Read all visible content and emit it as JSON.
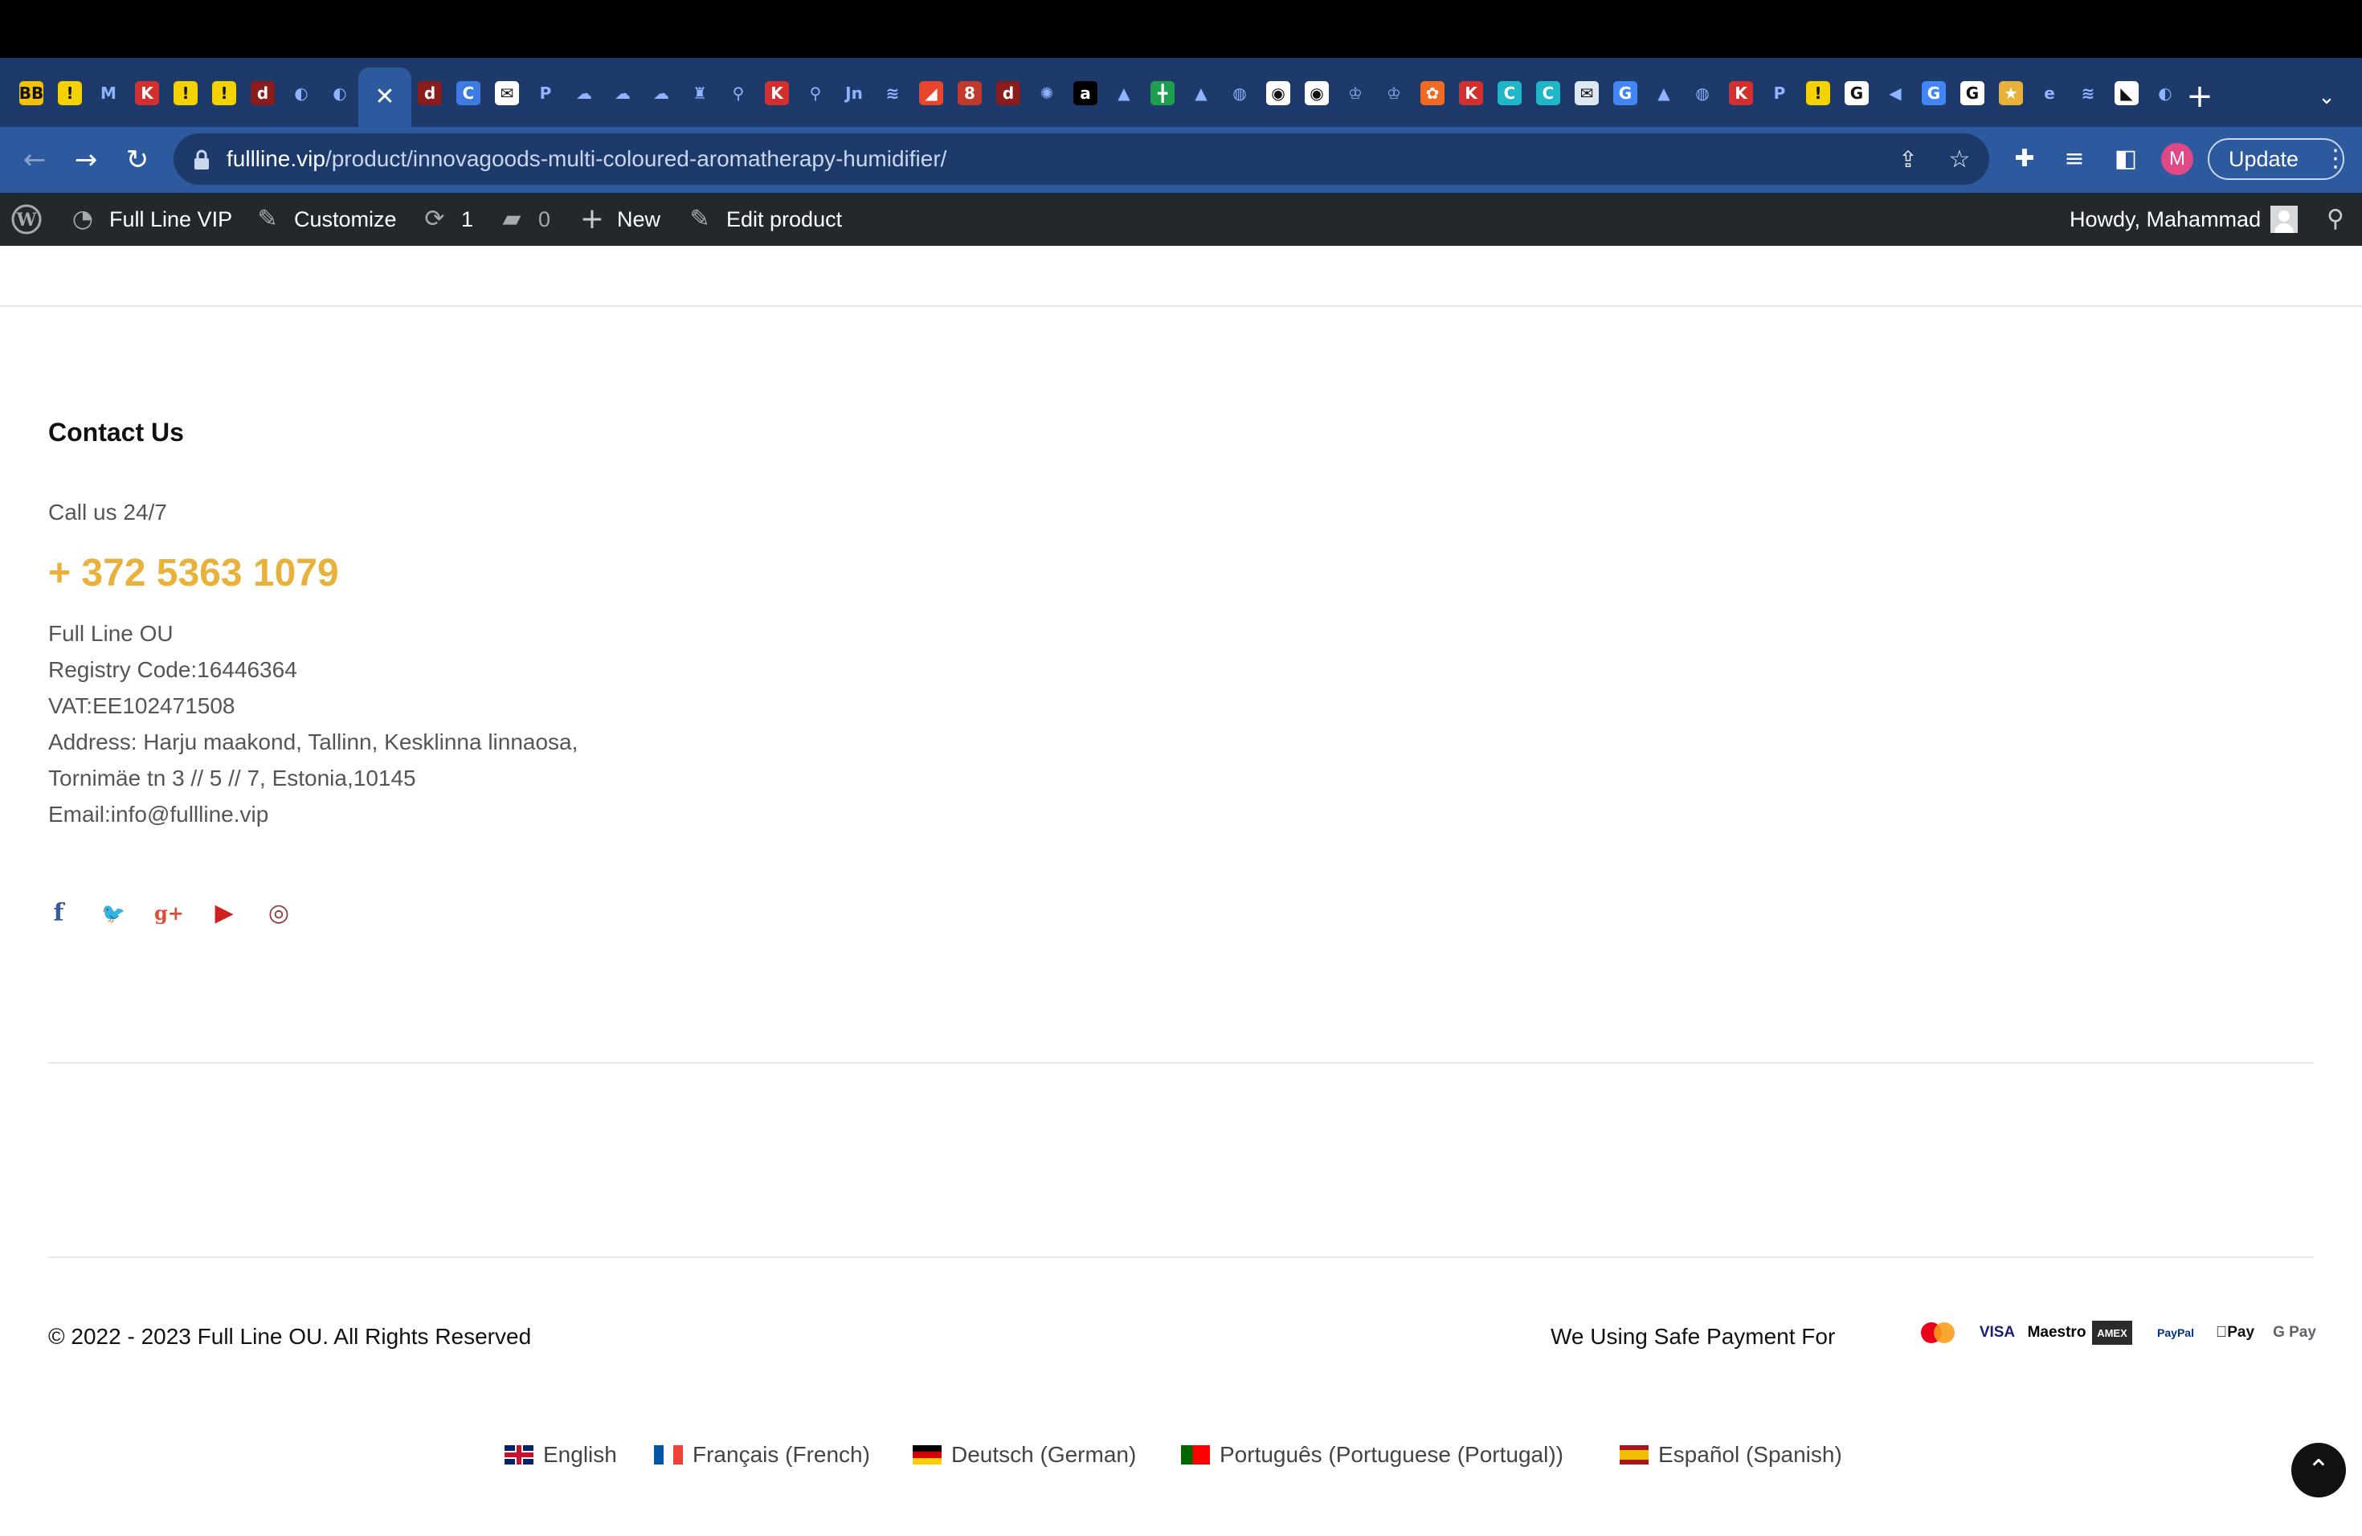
{
  "browser": {
    "tabs": [
      {
        "icon": "bigbuy-favicon-icon",
        "color": "#f2c200",
        "glyph": "BB"
      },
      {
        "icon": "exclamation-favicon-icon",
        "color": "#f2d200",
        "glyph": "!"
      },
      {
        "icon": "gmail-favicon-icon",
        "color": "#1d3a6b",
        "glyph": "M"
      },
      {
        "icon": "red-k-favicon-icon",
        "color": "#d32f2f",
        "glyph": "K"
      },
      {
        "icon": "exclamation-favicon-icon",
        "color": "#f2d200",
        "glyph": "!"
      },
      {
        "icon": "exclamation-favicon-icon",
        "color": "#f2d200",
        "glyph": "!"
      },
      {
        "icon": "red-logo-favicon-icon",
        "color": "#8a1c1c",
        "glyph": "d"
      },
      {
        "icon": "loading-favicon-icon",
        "color": "#1d3a6b",
        "glyph": "◐"
      },
      {
        "icon": "loading-favicon-icon",
        "color": "#1d3a6b",
        "glyph": "◐"
      },
      {
        "icon": "red-logo-favicon-icon",
        "color": "#8a1c1c",
        "glyph": "d"
      },
      {
        "icon": "c-circle-favicon-icon",
        "color": "#3d7be0",
        "glyph": "C"
      },
      {
        "icon": "mail-favicon-icon",
        "color": "#ffffff",
        "glyph": "✉"
      },
      {
        "icon": "p-favicon-icon",
        "color": "#1d3a6b",
        "glyph": "P"
      },
      {
        "icon": "cloud-favicon-icon",
        "color": "#1d3a6b",
        "glyph": "☁"
      },
      {
        "icon": "cloud-favicon-icon",
        "color": "#1d3a6b",
        "glyph": "☁"
      },
      {
        "icon": "cloud-favicon-icon",
        "color": "#1d3a6b",
        "glyph": "☁"
      },
      {
        "icon": "figure-favicon-icon",
        "color": "#1d3a6b",
        "glyph": "♜"
      },
      {
        "icon": "connect-favicon-icon",
        "color": "#1d3a6b",
        "glyph": "⚲"
      },
      {
        "icon": "red-k-favicon-icon",
        "color": "#d32f2f",
        "glyph": "K"
      },
      {
        "icon": "connect-favicon-icon",
        "color": "#1d3a6b",
        "glyph": "⚲"
      },
      {
        "icon": "jn-favicon-icon",
        "color": "#1d3a6b",
        "glyph": "Jn"
      },
      {
        "icon": "layers-favicon-icon",
        "color": "#1d3a6b",
        "glyph": "≋"
      },
      {
        "icon": "red-leaf-favicon-icon",
        "color": "#e8452c",
        "glyph": "◢"
      },
      {
        "icon": "badge-8-favicon-icon",
        "color": "#c0392b",
        "glyph": "8"
      },
      {
        "icon": "red-logo-favicon-icon",
        "color": "#8a1c1c",
        "glyph": "d"
      },
      {
        "icon": "octopus-favicon-icon",
        "color": "#1d3a6b",
        "glyph": "✺"
      },
      {
        "icon": "a-favicon-icon",
        "color": "#000000",
        "glyph": "a"
      },
      {
        "icon": "drive-favicon-icon",
        "color": "#1d3a6b",
        "glyph": "▲"
      },
      {
        "icon": "sheets-favicon-icon",
        "color": "#1e9e4f",
        "glyph": "╋"
      },
      {
        "icon": "drive-favicon-icon",
        "color": "#1d3a6b",
        "glyph": "▲"
      },
      {
        "icon": "globe-favicon-icon",
        "color": "#1d3a6b",
        "glyph": "◍"
      },
      {
        "icon": "o-favicon-icon",
        "color": "#ffffff",
        "glyph": "◉"
      },
      {
        "icon": "o-favicon-icon",
        "color": "#ffffff",
        "glyph": "◉"
      },
      {
        "icon": "crown-favicon-icon",
        "color": "#1d3a6b",
        "glyph": "♔"
      },
      {
        "icon": "crown-favicon-icon",
        "color": "#1d3a6b",
        "glyph": "♔"
      },
      {
        "icon": "orange-favicon-icon",
        "color": "#f06a22",
        "glyph": "✿"
      },
      {
        "icon": "red-k-favicon-icon",
        "color": "#d32f2f",
        "glyph": "K"
      },
      {
        "icon": "c-favicon-icon",
        "color": "#1fb6c9",
        "glyph": "C"
      },
      {
        "icon": "c-favicon-icon",
        "color": "#1fb6c9",
        "glyph": "C"
      },
      {
        "icon": "mail-favicon-icon",
        "color": "#dfe7f3",
        "glyph": "✉"
      },
      {
        "icon": "translate-favicon-icon",
        "color": "#4285f4",
        "glyph": "G"
      },
      {
        "icon": "drive-favicon-icon",
        "color": "#1d3a6b",
        "glyph": "▲"
      },
      {
        "icon": "globe-favicon-icon",
        "color": "#1d3a6b",
        "glyph": "◍"
      },
      {
        "icon": "red-k-favicon-icon",
        "color": "#d32f2f",
        "glyph": "K"
      },
      {
        "icon": "paypal-favicon-icon",
        "color": "#1d3a6b",
        "glyph": "P"
      },
      {
        "icon": "exclamation-favicon-icon",
        "color": "#f2d200",
        "glyph": "!"
      },
      {
        "icon": "google-favicon-icon",
        "color": "#ffffff",
        "glyph": "G"
      },
      {
        "icon": "speaker-favicon-icon",
        "color": "#1d3a6b",
        "glyph": "◀"
      },
      {
        "icon": "translate-favicon-icon",
        "color": "#4285f4",
        "glyph": "G"
      },
      {
        "icon": "google-favicon-icon",
        "color": "#ffffff",
        "glyph": "G"
      },
      {
        "icon": "person-favicon-icon",
        "color": "#e8b23a",
        "glyph": "★"
      },
      {
        "icon": "e-favicon-icon",
        "color": "#1d3a6b",
        "glyph": "e"
      },
      {
        "icon": "layers-favicon-icon",
        "color": "#1d3a6b",
        "glyph": "≋"
      },
      {
        "icon": "dog-favicon-icon",
        "color": "#ffffff",
        "glyph": "◣"
      },
      {
        "icon": "loading-favicon-icon",
        "color": "#1d3a6b",
        "glyph": "◐"
      }
    ],
    "url_host": "fullline.vip",
    "url_path": "/product/innovagoods-multi-coloured-aromatherapy-humidifier/",
    "profile_initial": "M",
    "update_label": "Update"
  },
  "adminbar": {
    "site_name": "Full Line VIP",
    "customize": "Customize",
    "updates_count": "1",
    "comments_count": "0",
    "new": "New",
    "edit_product": "Edit product",
    "howdy": "Howdy, Mahammad"
  },
  "contact": {
    "title": "Contact Us",
    "call_label": "Call us 24/7",
    "phone": "+ 372 5363 1079",
    "lines": [
      "Full Line OU",
      "Registry Code:16446364",
      "VAT:EE102471508",
      "Address: Harju maakond, Tallinn, Kesklinna linnaosa,",
      "Tornimäe tn 3 // 5 // 7, Estonia,10145",
      "Email:info@fullline.vip"
    ]
  },
  "social": [
    {
      "name": "facebook-icon",
      "glyph": "f",
      "color": "#3b5998"
    },
    {
      "name": "twitter-icon",
      "glyph": "🐦",
      "color": "#55acee"
    },
    {
      "name": "google-plus-icon",
      "glyph": "g+",
      "color": "#dd4b39"
    },
    {
      "name": "youtube-icon",
      "glyph": "▶",
      "color": "#cd201f"
    },
    {
      "name": "instagram-icon",
      "glyph": "◎",
      "color": "#8a3a3a"
    }
  ],
  "footer": {
    "copyright": "© 2022 - 2023 Full Line OU. All Rights Reserved",
    "safe_payment": "We Using Safe Payment For",
    "payments": [
      {
        "name": "mastercard-icon",
        "label": ""
      },
      {
        "name": "visa-icon",
        "label": "VISA"
      },
      {
        "name": "maestro-icon",
        "label": "Maestro"
      },
      {
        "name": "amex-icon",
        "label": "AMEX"
      },
      {
        "name": "paypal-icon",
        "label": "PayPal"
      },
      {
        "name": "apple-pay-icon",
        "label": "Pay"
      },
      {
        "name": "google-pay-icon",
        "label": "G Pay"
      }
    ]
  },
  "languages": [
    {
      "label": "English",
      "flag": "uk"
    },
    {
      "label": "Français (French)",
      "flag": "fr"
    },
    {
      "label": "Deutsch (German)",
      "flag": "de"
    },
    {
      "label": "Português (Portuguese (Portugal))",
      "flag": "pt"
    },
    {
      "label": "Español (Spanish)",
      "flag": "es"
    }
  ],
  "colors": {
    "accent": "#e8b23a",
    "tab_strip": "#1d3a6b",
    "toolbar": "#2d5a9e",
    "adminbar": "#23282d"
  }
}
